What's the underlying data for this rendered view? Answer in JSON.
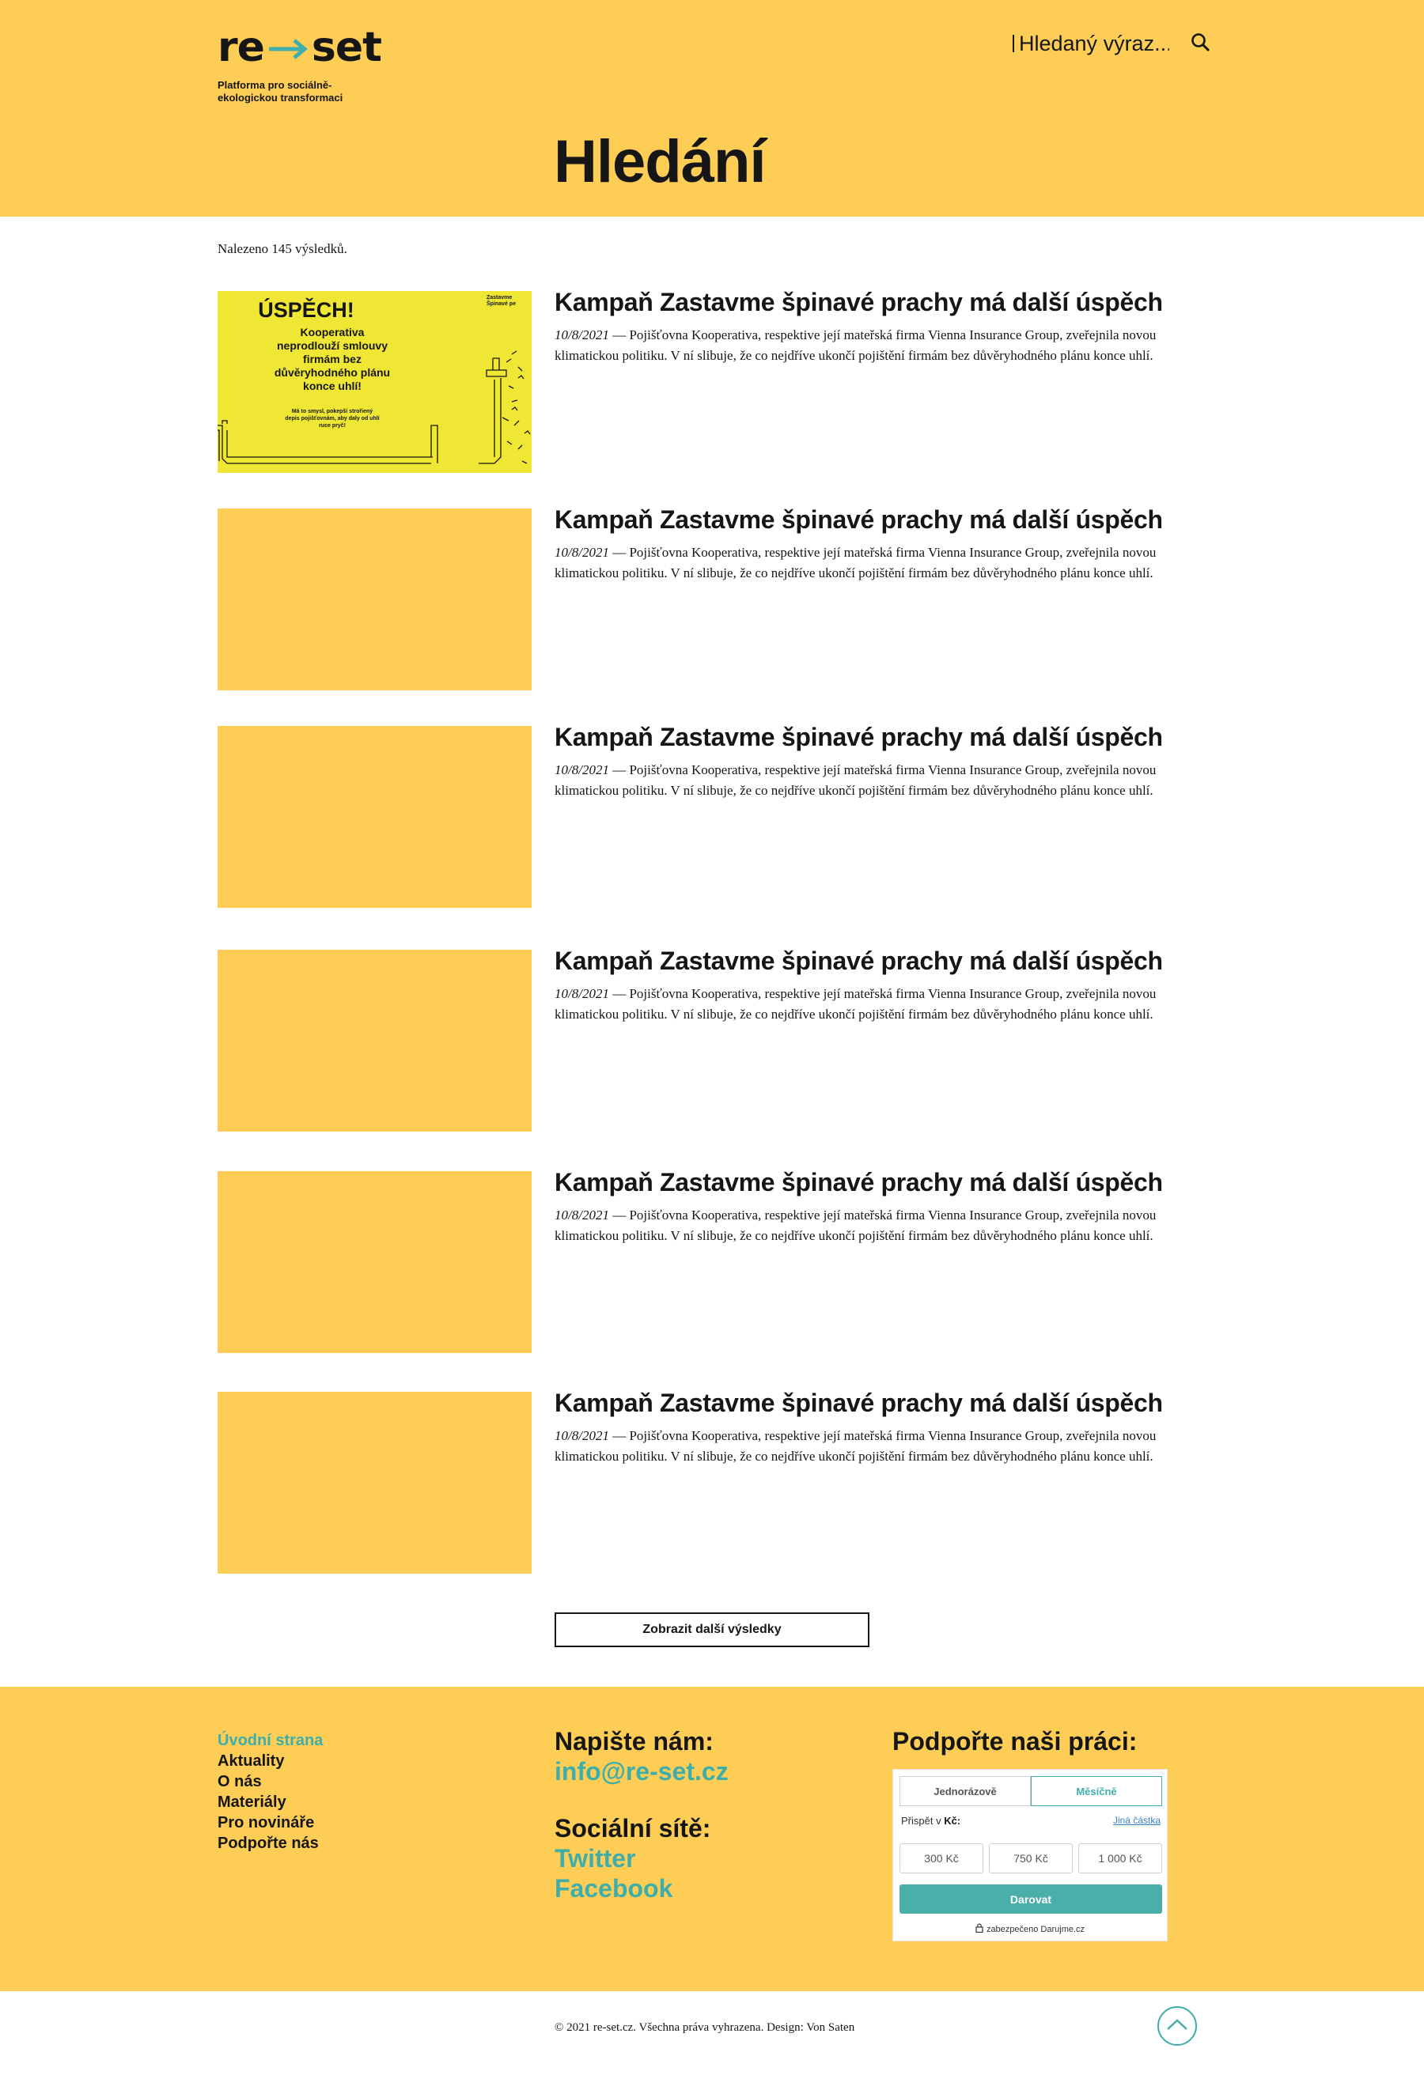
{
  "logo": {
    "text_left": "re",
    "text_right": "set",
    "tagline": "Platforma pro sociálně-ekologickou transformaci"
  },
  "search": {
    "placeholder": "Hledaný výraz..."
  },
  "page_title": "Hledání",
  "result_count": "Nalezeno 145 výsledků.",
  "thumbnail_text": {
    "heading": "ÚSPĚCH!",
    "body": "Kooperativa neprodlouží smlouvy firmám bez důvěryhodného plánu konce uhlí!",
    "small": "Má to smysl, pokepší strořiený depis pojišťovnám, aby daly od uhlí ruce pryč!",
    "brand": "Zastavme Špinavé pe"
  },
  "results": [
    {
      "title": "Kampaň Zastavme špinavé prachy má další úspěch",
      "date": "10/8/2021",
      "excerpt": " — Pojišťovna Kooperativa, respektive její mateřská firma Vienna Insurance Group, zveřejnila novou klimatickou politiku. V ní slibuje, že co nejdříve ukončí pojištění firmám bez důvěryhodného plánu konce uhlí."
    },
    {
      "title": "Kampaň Zastavme špinavé prachy má další úspěch",
      "date": "10/8/2021",
      "excerpt": " — Pojišťovna Kooperativa, respektive její mateřská firma Vienna Insurance Group, zveřejnila novou klimatickou politiku. V ní slibuje, že co nejdříve ukončí pojištění firmám bez důvěryhodného plánu konce uhlí."
    },
    {
      "title": "Kampaň Zastavme špinavé prachy má další úspěch",
      "date": "10/8/2021",
      "excerpt": " — Pojišťovna Kooperativa, respektive její mateřská firma Vienna Insurance Group, zveřejnila novou klimatickou politiku. V ní slibuje, že co nejdříve ukončí pojištění firmám bez důvěryhodného plánu konce uhlí."
    },
    {
      "title": "Kampaň Zastavme špinavé prachy má další úspěch",
      "date": "10/8/2021",
      "excerpt": " — Pojišťovna Kooperativa, respektive její mateřská firma Vienna Insurance Group, zveřejnila novou klimatickou politiku. V ní slibuje, že co nejdříve ukončí pojištění firmám bez důvěryhodného plánu konce uhlí."
    },
    {
      "title": "Kampaň Zastavme špinavé prachy má další úspěch",
      "date": "10/8/2021",
      "excerpt": " — Pojišťovna Kooperativa, respektive její mateřská firma Vienna Insurance Group, zveřejnila novou klimatickou politiku. V ní slibuje, že co nejdříve ukončí pojištění firmám bez důvěryhodného plánu konce uhlí."
    },
    {
      "title": "Kampaň Zastavme špinavé prachy má další úspěch",
      "date": "10/8/2021",
      "excerpt": " — Pojišťovna Kooperativa, respektive její mateřská firma Vienna Insurance Group, zveřejnila novou klimatickou politiku. V ní slibuje, že co nejdříve ukončí pojištění firmám bez důvěryhodného plánu konce uhlí."
    }
  ],
  "more_button": "Zobrazit další výsledky",
  "footer": {
    "nav": [
      {
        "label": "Úvodní strana",
        "active": true
      },
      {
        "label": "Aktuality"
      },
      {
        "label": "O nás"
      },
      {
        "label": "Materiály"
      },
      {
        "label": "Pro novináře"
      },
      {
        "label": "Podpořte nás"
      }
    ],
    "contact_heading": "Napište nám:",
    "email": "info@re-set.cz",
    "social_heading": "Sociální sítě:",
    "twitter": "Twitter",
    "facebook": "Facebook",
    "support_heading": "Podpořte naši práci:",
    "widget": {
      "tab_once": "Jednorázově",
      "tab_monthly": "Měsíčně",
      "label": "Přispět v ",
      "currency": "Kč:",
      "other": "Jiná částka",
      "amounts": [
        "300 Kč",
        "750 Kč",
        "1 000 Kč"
      ],
      "donate": "Darovat",
      "secure": "zabezpečeno Darujme.cz"
    }
  },
  "copyright": "© 2021 re-set.cz. Všechna práva vyhrazena. Design: Von Saten",
  "colors": {
    "brand_yellow": "#fdcd55",
    "accent_teal": "#3faeaa",
    "text": "#161616"
  },
  "icons": [
    "arrow-logo-icon",
    "search-icon",
    "lock-icon",
    "chevron-up-icon"
  ]
}
